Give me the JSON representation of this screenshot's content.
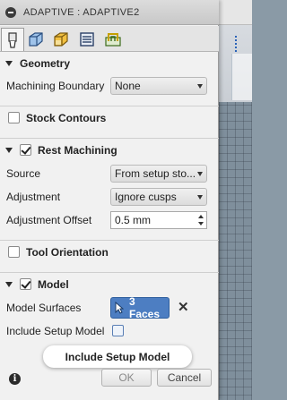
{
  "window": {
    "title": "ADAPTIVE : ADAPTIVE2"
  },
  "tabs": [
    {
      "icon": "tool-icon",
      "active": true
    },
    {
      "icon": "geometry-icon",
      "active": false
    },
    {
      "icon": "heights-icon",
      "active": false
    },
    {
      "icon": "passes-icon",
      "active": false
    },
    {
      "icon": "linking-icon",
      "active": false
    }
  ],
  "geometry": {
    "header": "Geometry",
    "machining_boundary_label": "Machining Boundary",
    "machining_boundary_value": "None"
  },
  "stock_contours": {
    "header": "Stock Contours",
    "checked": false
  },
  "rest_machining": {
    "header": "Rest Machining",
    "checked": true,
    "source_label": "Source",
    "source_value": "From setup sto...",
    "adjustment_label": "Adjustment",
    "adjustment_value": "Ignore cusps",
    "adjustment_offset_label": "Adjustment Offset",
    "adjustment_offset_value": "0.5 mm"
  },
  "tool_orientation": {
    "header": "Tool Orientation",
    "checked": false
  },
  "model": {
    "header": "Model",
    "checked": true,
    "model_surfaces_label": "Model Surfaces",
    "model_surfaces_value": "3 Faces",
    "include_setup_model_label": "Include Setup Model",
    "include_setup_model_checked": false
  },
  "tooltip": {
    "text": "Include Setup Model"
  },
  "footer": {
    "info": "i",
    "ok_label": "OK",
    "cancel_label": "Cancel"
  },
  "colors": {
    "accent": "#4d7ec2",
    "axis": "#2a63b8"
  }
}
